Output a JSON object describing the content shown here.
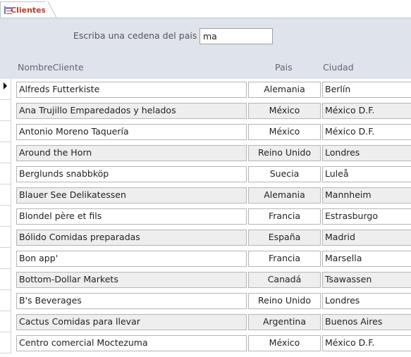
{
  "tab": {
    "label": "Clientes",
    "icon": "form-icon"
  },
  "search": {
    "label": "Escriba una cedena del pais",
    "value": "ma"
  },
  "columns": {
    "name": "NombreCliente",
    "pais": "Pais",
    "ciudad": "Ciudad"
  },
  "rows": [
    {
      "name": "Alfreds Futterkiste",
      "pais": "Alemania",
      "ciudad": "Berlín"
    },
    {
      "name": "Ana Trujillo Emparedados y helados",
      "pais": "México",
      "ciudad": "México D.F."
    },
    {
      "name": "Antonio Moreno Taquería",
      "pais": "México",
      "ciudad": "México D.F."
    },
    {
      "name": "Around the Horn",
      "pais": "Reino Unido",
      "ciudad": "Londres"
    },
    {
      "name": "Berglunds snabbköp",
      "pais": "Suecia",
      "ciudad": "Luleå"
    },
    {
      "name": "Blauer See Delikatessen",
      "pais": "Alemania",
      "ciudad": "Mannheim"
    },
    {
      "name": "Blondel père et fils",
      "pais": "Francia",
      "ciudad": "Estrasburgo"
    },
    {
      "name": "Bólido Comidas preparadas",
      "pais": "España",
      "ciudad": "Madrid"
    },
    {
      "name": "Bon app'",
      "pais": "Francia",
      "ciudad": "Marsella"
    },
    {
      "name": "Bottom-Dollar Markets",
      "pais": "Canadá",
      "ciudad": "Tsawassen"
    },
    {
      "name": "B's Beverages",
      "pais": "Reino Unido",
      "ciudad": "Londres"
    },
    {
      "name": "Cactus Comidas para llevar",
      "pais": "Argentina",
      "ciudad": "Buenos Aires"
    },
    {
      "name": "Centro comercial Moctezuma",
      "pais": "México",
      "ciudad": "México D.F."
    }
  ]
}
